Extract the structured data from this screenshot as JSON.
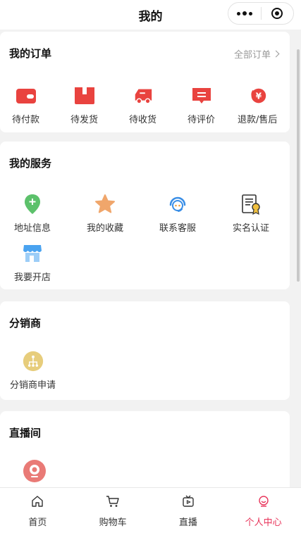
{
  "header": {
    "title": "我的"
  },
  "orders": {
    "title": "我的订单",
    "all_label": "全部订单",
    "items": [
      {
        "label": "待付款",
        "icon": "wallet-icon"
      },
      {
        "label": "待发货",
        "icon": "box-icon"
      },
      {
        "label": "待收货",
        "icon": "truck-icon"
      },
      {
        "label": "待评价",
        "icon": "comment-icon"
      },
      {
        "label": "退款/售后",
        "icon": "refund-icon"
      }
    ]
  },
  "services": {
    "title": "我的服务",
    "items": [
      {
        "label": "地址信息",
        "icon": "location-icon"
      },
      {
        "label": "我的收藏",
        "icon": "star-icon"
      },
      {
        "label": "联系客服",
        "icon": "headset-icon"
      },
      {
        "label": "实名认证",
        "icon": "certificate-icon"
      },
      {
        "label": "我要开店",
        "icon": "shop-icon"
      }
    ]
  },
  "distributor": {
    "title": "分销商",
    "items": [
      {
        "label": "分销商申请",
        "icon": "network-icon"
      }
    ]
  },
  "live": {
    "title": "直播间",
    "items": [
      {
        "label": "",
        "icon": "camera-icon"
      }
    ]
  },
  "tabbar": {
    "tabs": [
      {
        "label": "首页",
        "icon": "home-icon"
      },
      {
        "label": "购物车",
        "icon": "cart-icon"
      },
      {
        "label": "直播",
        "icon": "live-icon"
      },
      {
        "label": "个人中心",
        "icon": "profile-icon"
      }
    ],
    "active": "个人中心"
  },
  "colors": {
    "accent": "#e8345a",
    "order_red": "#e9433f"
  }
}
